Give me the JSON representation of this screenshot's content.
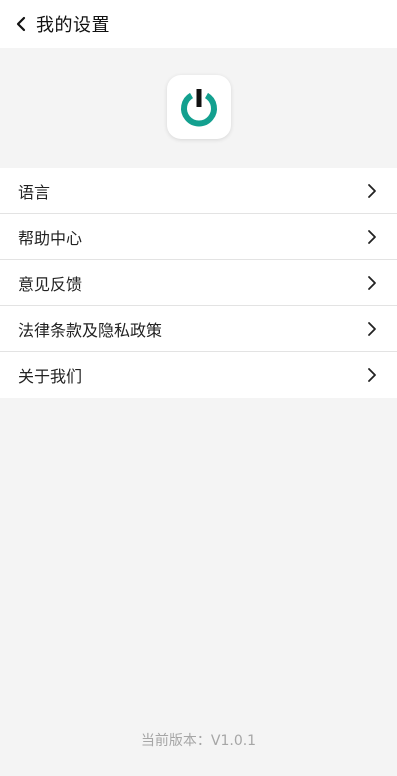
{
  "header": {
    "title": "我的设置",
    "back_icon": "chevron-left-icon"
  },
  "logo": {
    "icon": "power-icon",
    "ring_color": "#13a08f",
    "bar_color": "#111111"
  },
  "menu": {
    "items": [
      {
        "label": "语言",
        "icon": "chevron-right-icon"
      },
      {
        "label": "帮助中心",
        "icon": "chevron-right-icon"
      },
      {
        "label": "意见反馈",
        "icon": "chevron-right-icon"
      },
      {
        "label": "法律条款及隐私政策",
        "icon": "chevron-right-icon"
      },
      {
        "label": "关于我们",
        "icon": "chevron-right-icon"
      }
    ]
  },
  "footer": {
    "version_text": "当前版本：V1.0.1"
  },
  "colors": {
    "background": "#f4f4f4",
    "surface": "#ffffff",
    "divider": "#e3e3e3",
    "muted_text": "#a6a6a6"
  }
}
